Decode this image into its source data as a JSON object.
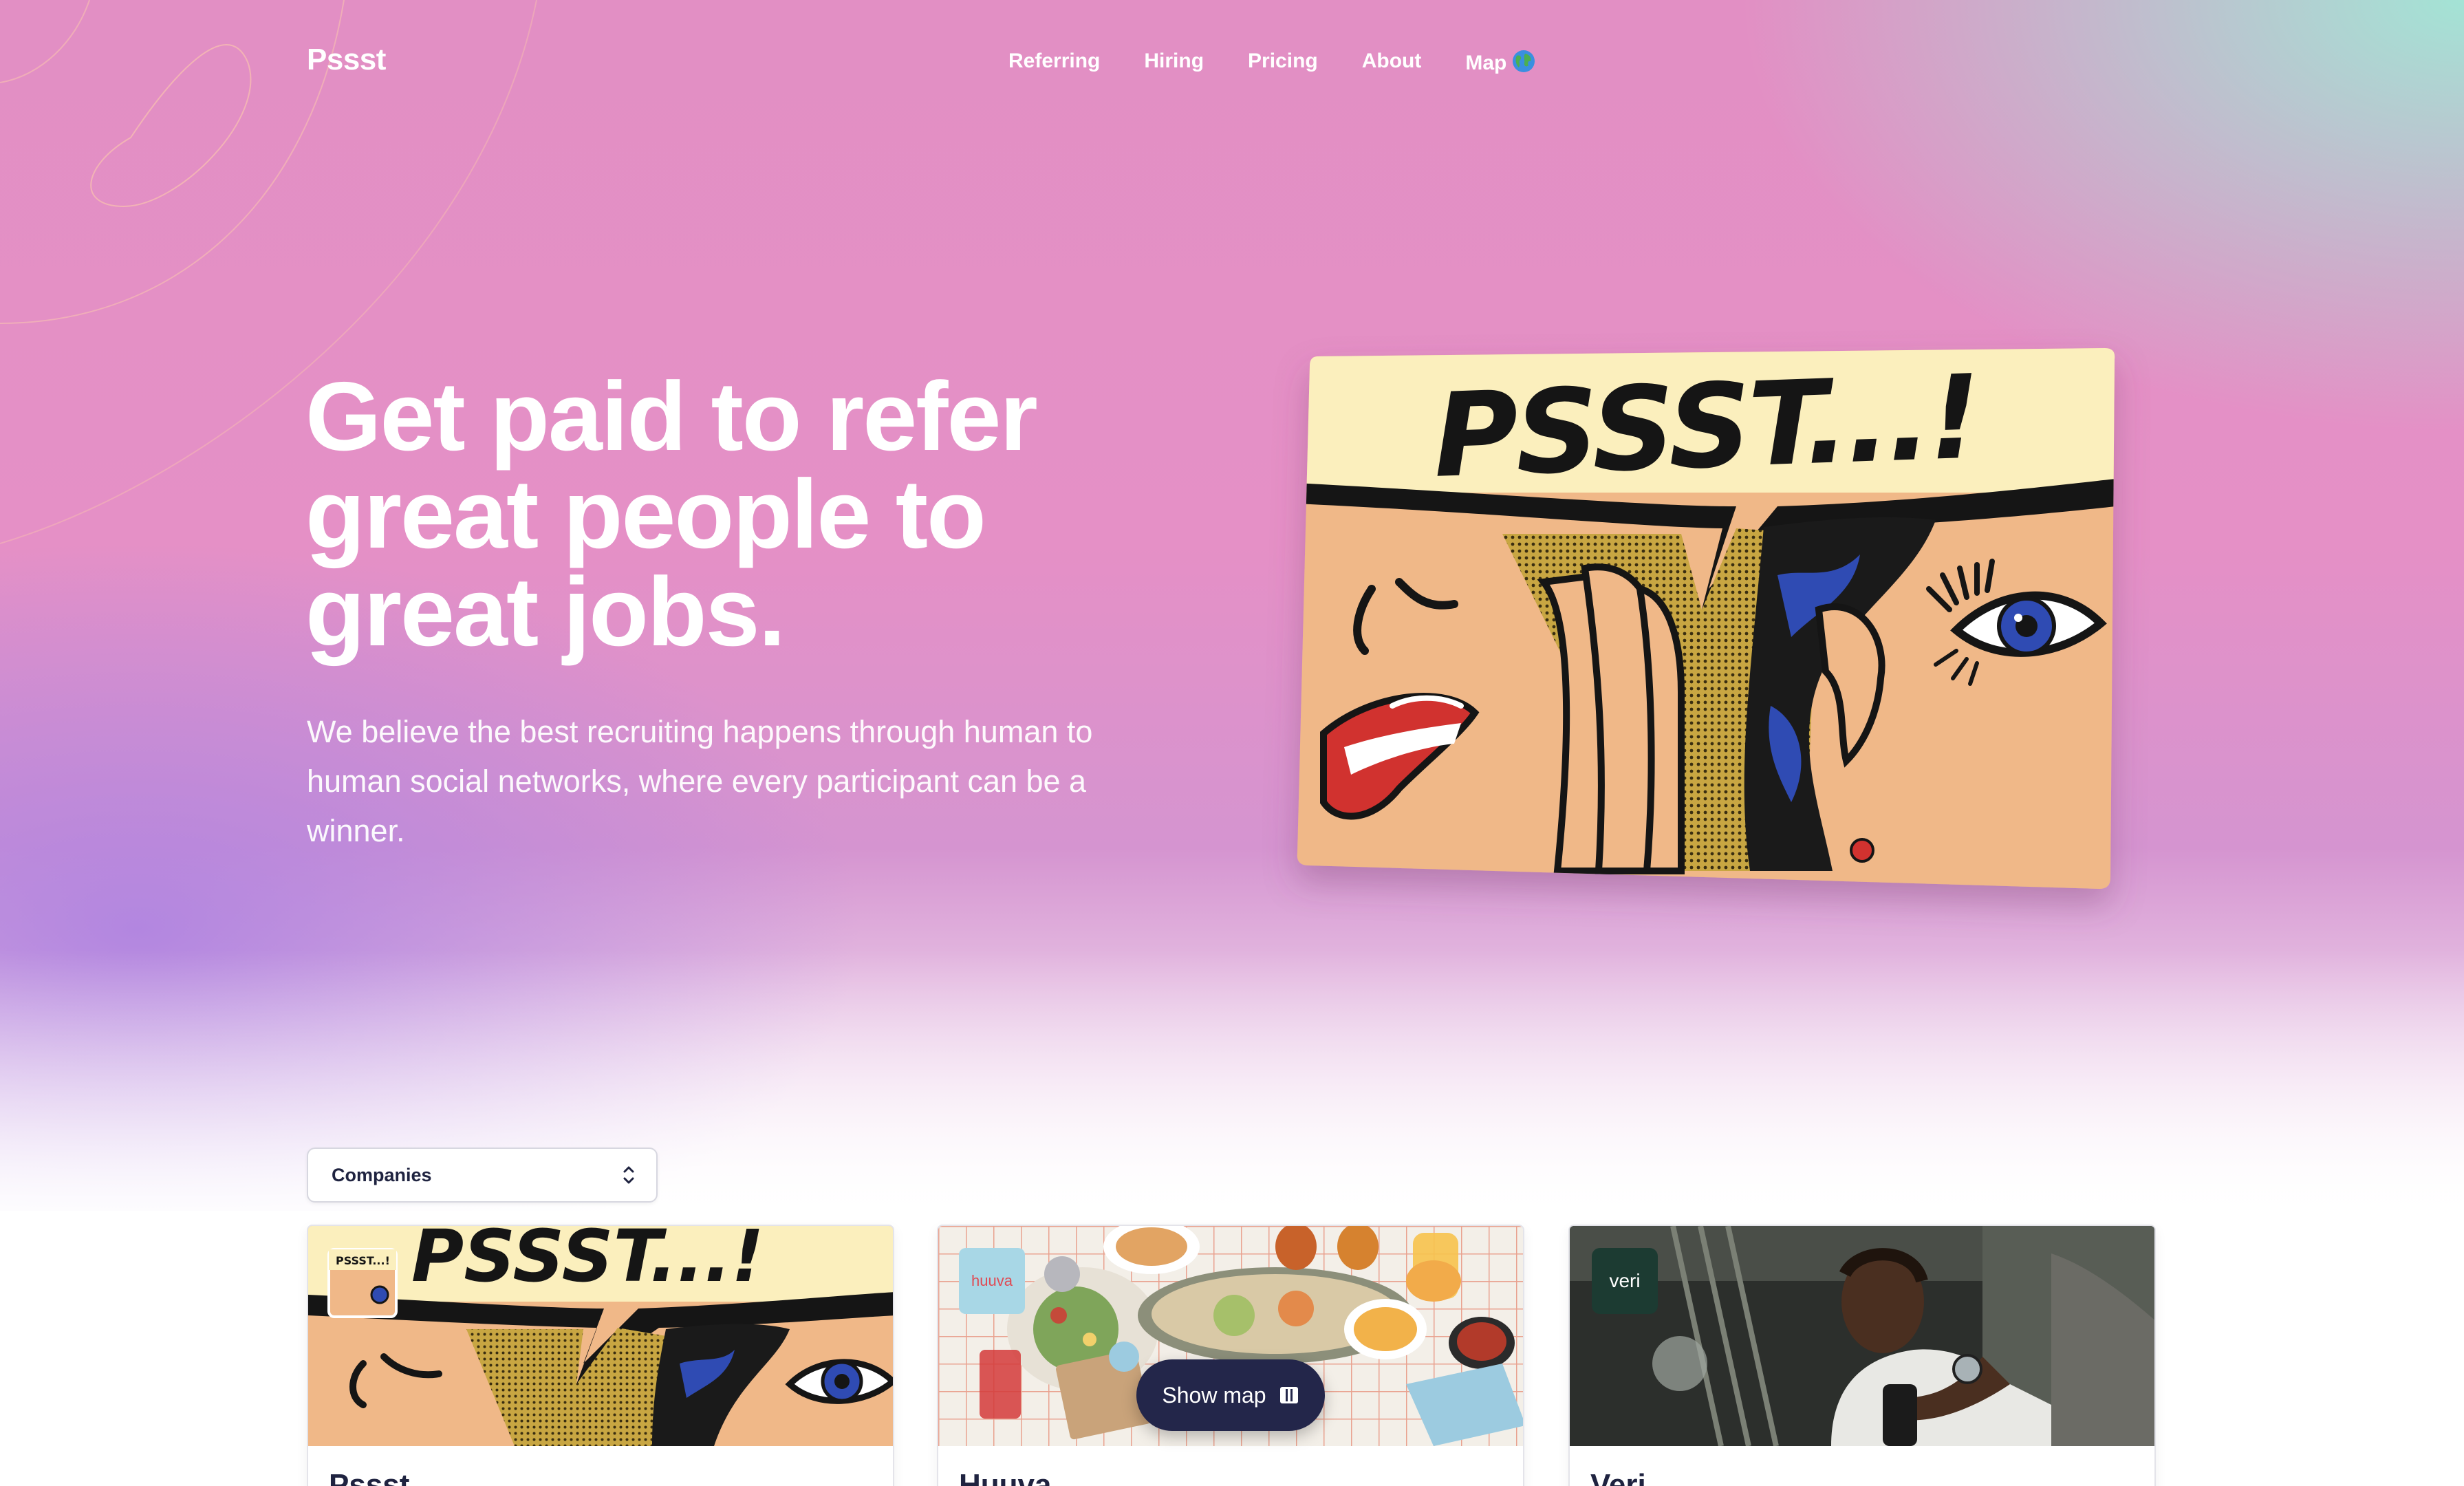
{
  "nav": {
    "logo": "Pssst",
    "links": [
      {
        "label": "Referring"
      },
      {
        "label": "Hiring"
      },
      {
        "label": "Pricing"
      },
      {
        "label": "About"
      },
      {
        "label": "Map"
      }
    ]
  },
  "hero": {
    "headline_lines": [
      "Get paid to refer",
      "great people to",
      "great jobs."
    ],
    "subhead": "We believe the best recruiting happens through human to human social networks, where every participant can be a winner.",
    "comic_text": "PSSST...!"
  },
  "filter": {
    "selected": "Companies"
  },
  "cards": [
    {
      "title": "Pssst",
      "badge": "PSSST...!"
    },
    {
      "title": "Huuva",
      "badge": "huuva"
    },
    {
      "title": "Veri",
      "badge": "veri"
    }
  ],
  "show_map": {
    "label": "Show map"
  },
  "colors": {
    "navy": "#23264a",
    "pink": "#e590c6",
    "mint": "#a0e8d6",
    "violet": "#b084e0"
  }
}
